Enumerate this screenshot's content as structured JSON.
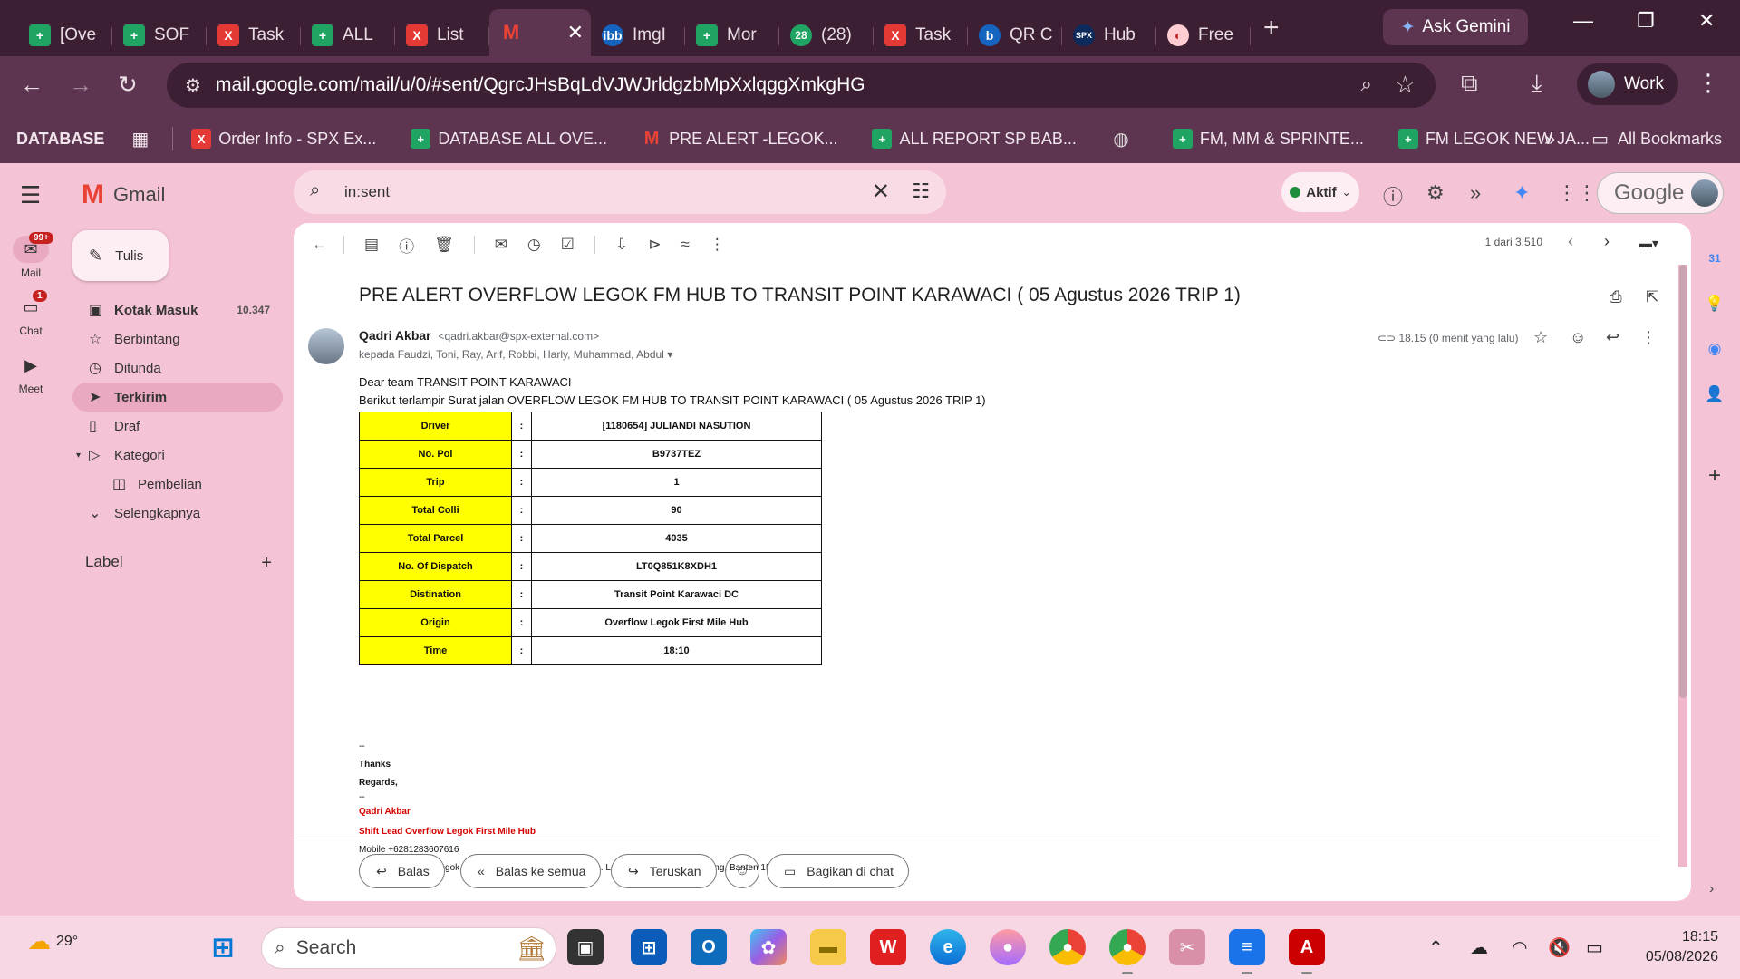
{
  "browser": {
    "tabs": [
      {
        "label": "[Ove",
        "icon": "sheets-icon",
        "color": "green",
        "glyph": "+"
      },
      {
        "label": "SOF",
        "icon": "sheets-icon",
        "color": "green",
        "glyph": "+"
      },
      {
        "label": "Task",
        "icon": "x-app-icon",
        "color": "red",
        "glyph": "X"
      },
      {
        "label": "ALL",
        "icon": "sheets-icon",
        "color": "green",
        "glyph": "+"
      },
      {
        "label": "List",
        "icon": "x-app-icon",
        "color": "red",
        "glyph": "X"
      },
      {
        "label": "",
        "icon": "gmail-icon",
        "color": "gm",
        "glyph": "M",
        "active": true
      },
      {
        "label": "ImgI",
        "icon": "ibb-icon",
        "color": "blue",
        "glyph": "ibb"
      },
      {
        "label": "Mor",
        "icon": "sheets-icon",
        "color": "green",
        "glyph": "+"
      },
      {
        "label": "(28)",
        "icon": "whatsapp-icon",
        "color": "teal",
        "glyph": "28"
      },
      {
        "label": "Task",
        "icon": "x-app-icon",
        "color": "red",
        "glyph": "X"
      },
      {
        "label": "QR C",
        "icon": "qr-icon",
        "color": "blue",
        "glyph": "b"
      },
      {
        "label": "Hub",
        "icon": "spx-icon",
        "color": "navy",
        "glyph": "SPX"
      },
      {
        "label": "Free",
        "icon": "free-app-icon",
        "color": "pink",
        "glyph": "◐"
      }
    ],
    "new_tab": "+",
    "ask_gemini": "Ask Gemini",
    "url": "mail.google.com/mail/u/0/#sent/QgrcJHsBqLdVJWJrldgzbMpXxlqggXmkgHG",
    "profile": "Work",
    "bookmarks": {
      "folder": "DATABASE",
      "items": [
        {
          "label": "Order Info - SPX Ex...",
          "icon": "x-app-icon",
          "color": "#e53935",
          "glyph": "X"
        },
        {
          "label": "DATABASE ALL OVE...",
          "icon": "sheets-icon",
          "color": "#1fa463",
          "glyph": "+"
        },
        {
          "label": "PRE ALERT -LEGOK...",
          "icon": "gmail-icon",
          "color": "transparent",
          "glyph": "M"
        },
        {
          "label": "ALL REPORT SP BAB...",
          "icon": "sheets-icon",
          "color": "#1fa463",
          "glyph": "+"
        },
        {
          "label": "",
          "icon": "globe-icon",
          "color": "transparent",
          "glyph": "◍"
        },
        {
          "label": "FM, MM & SPRINTE...",
          "icon": "sheets-icon",
          "color": "#1fa463",
          "glyph": "+"
        },
        {
          "label": "FM LEGOK NEW JA...",
          "icon": "sheets-icon",
          "color": "#1fa463",
          "glyph": "+"
        }
      ],
      "more": "»",
      "all": "All Bookmarks"
    }
  },
  "gmail": {
    "app_name": "Gmail",
    "search_query": "in:sent",
    "status": "Aktif",
    "account_word": "Google",
    "rail": [
      {
        "label": "Mail",
        "badge": "99+",
        "icon": "mail-icon",
        "glyph": "✉"
      },
      {
        "label": "Chat",
        "badge": "1",
        "icon": "chat-icon",
        "glyph": "▭"
      },
      {
        "label": "Meet",
        "badge": "",
        "icon": "meet-icon",
        "glyph": "▶"
      }
    ],
    "compose": "Tulis",
    "folders": [
      {
        "label": "Kotak Masuk",
        "count": "10.347",
        "icon": "inbox-icon",
        "glyph": "▣",
        "bold": true
      },
      {
        "label": "Berbintang",
        "count": "",
        "icon": "star-icon",
        "glyph": "☆"
      },
      {
        "label": "Ditunda",
        "count": "",
        "icon": "clock-icon",
        "glyph": "◷"
      },
      {
        "label": "Terkirim",
        "count": "",
        "icon": "sent-icon",
        "glyph": "➤",
        "selected": true
      },
      {
        "label": "Draf",
        "count": "",
        "icon": "draft-icon",
        "glyph": "▯"
      },
      {
        "label": "Kategori",
        "count": "",
        "icon": "category-icon",
        "glyph": "▷"
      },
      {
        "label": "Pembelian",
        "count": "",
        "icon": "purchase-icon",
        "glyph": "◫",
        "sub": true
      },
      {
        "label": "Selengkapnya",
        "count": "",
        "icon": "chevron-down-icon",
        "glyph": "⌄"
      }
    ],
    "labels_header": "Label",
    "pager": "1 dari 3.510",
    "email": {
      "subject": "PRE ALERT OVERFLOW LEGOK FM HUB TO TRANSIT POINT KARAWACI ( 05 Agustus 2026 TRIP 1)",
      "sender_name": "Qadri Akbar",
      "sender_email": "<qadri.akbar@spx-external.com>",
      "recipients": "kepada Faudzi, Toni, Ray, Arif, Robbi, Harly, Muhammad, Abdul",
      "time": "18.15 (0 menit yang lalu)",
      "greeting": "Dear team TRANSIT POINT  KARAWACI",
      "intro": "Berikut terlampir Surat jalan OVERFLOW LEGOK FM HUB TO TRANSIT POINT KARAWACI ( 05 Agustus 2026 TRIP 1)",
      "table": [
        {
          "key": "Driver",
          "value": "[1180654] JULIANDI NASUTION"
        },
        {
          "key": "No. Pol",
          "value": "B9737TEZ"
        },
        {
          "key": "Trip",
          "value": "1"
        },
        {
          "key": "Total Colli",
          "value": "90"
        },
        {
          "key": "Total Parcel",
          "value": "4035"
        },
        {
          "key": "No. Of Dispatch",
          "value": "LT0Q851K8XDH1"
        },
        {
          "key": "Distination",
          "value": "Transit Point Karawaci DC"
        },
        {
          "key": "Origin",
          "value": "Overflow Legok First Mile Hub"
        },
        {
          "key": "Time",
          "value": "18:10"
        }
      ],
      "table_separator": ":",
      "sig_dash1": "--",
      "thanks": "Thanks",
      "regards": "Regards,",
      "sig_dash2": "--",
      "sig_name": "Qadri Akbar",
      "sig_title": "Shift Lead Overflow Legok First Mile Hub",
      "sig_mobile": "Mobile +6281283607616",
      "sig_address": "Address : Jl. Raya Legok - Karawaci No.KM 7.8, Legok, Kec. Legok, Kabupaten Tangerang, Banten 15820"
    },
    "reply_buttons": {
      "reply": "Balas",
      "reply_all": "Balas ke semua",
      "forward": "Teruskan",
      "share_chat": "Bagikan di chat"
    }
  },
  "taskbar": {
    "temperature": "29°",
    "search": "Search",
    "time": "18:15",
    "date": "05/08/2026"
  }
}
